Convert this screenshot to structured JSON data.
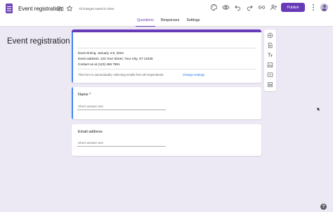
{
  "header": {
    "doc_title": "Event registration",
    "saved_status": "All changes saved in Drive",
    "publish_label": "Publish"
  },
  "tabs": [
    {
      "label": "Questions",
      "active": true
    },
    {
      "label": "Responses",
      "active": false
    },
    {
      "label": "Settings",
      "active": false
    }
  ],
  "form": {
    "title": "Event registration",
    "description": [
      "Event timing: January 4-6, 2024",
      "Event address: 123 Your Street, Your City, ST 12345",
      "Contact us at (123) 456 7891"
    ],
    "email_notice": "This form is automatically collecting emails from all respondents.",
    "change_settings_label": "Change settings"
  },
  "questions": [
    {
      "label": "Name *",
      "placeholder": "Short answer text"
    },
    {
      "label": "Email address",
      "placeholder": "Short answer text"
    }
  ],
  "side_toolbar": [
    "add-question-icon",
    "import-questions-icon",
    "add-title-icon",
    "add-image-icon",
    "add-video-icon",
    "add-section-icon"
  ],
  "help_label": "?",
  "colors": {
    "accent": "#673ab7",
    "background": "#ece8f4",
    "focus_bar": "#4285f4",
    "link": "#1a73e8"
  }
}
